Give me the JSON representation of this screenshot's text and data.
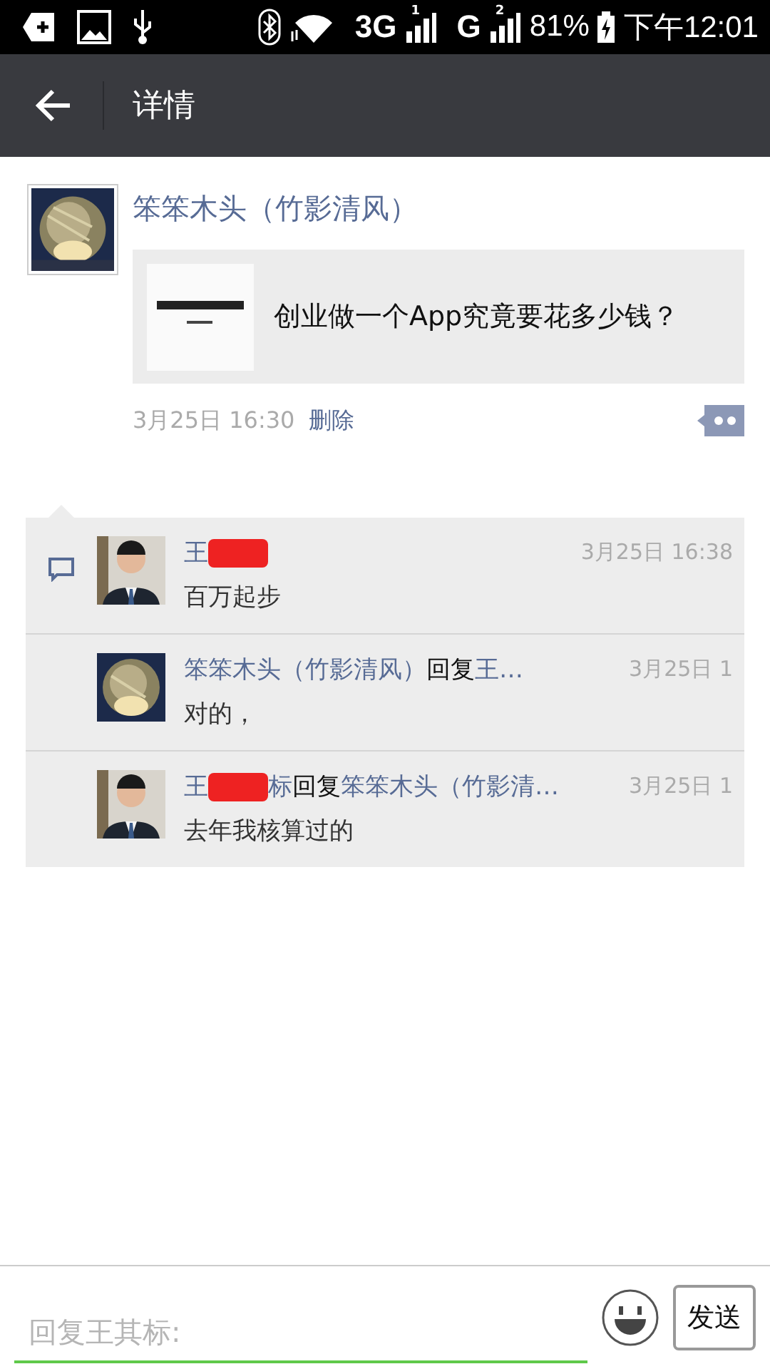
{
  "status_bar": {
    "network_1": "3G",
    "network_2": "G",
    "sim_1": "1",
    "sim_2": "2",
    "battery": "81%",
    "time": "下午12:01"
  },
  "toolbar": {
    "title": "详情"
  },
  "post": {
    "author": "笨笨木头（竹影清风）",
    "link_title": "创业做一个App究竟要花多少钱？",
    "time": "3月25日 16:30",
    "delete": "删除"
  },
  "comments": [
    {
      "kind": "comment",
      "author_parts": [
        "王"
      ],
      "redacted": true,
      "time": "3月25日 16:38",
      "text": "百万起步"
    },
    {
      "kind": "reply",
      "author_parts": [
        "笨笨木头（竹影清风）"
      ],
      "redacted": false,
      "reply_word": "回复",
      "target": "王…",
      "time": "3月25日 1",
      "text": "对的，"
    },
    {
      "kind": "reply",
      "author_parts": [
        "王",
        "标"
      ],
      "redacted": true,
      "reply_word": "回复",
      "target": "笨笨木头（竹影清…",
      "time": "3月25日 1",
      "text": "去年我核算过的"
    }
  ],
  "input": {
    "placeholder": "回复王其标:"
  },
  "send_button": "发送"
}
